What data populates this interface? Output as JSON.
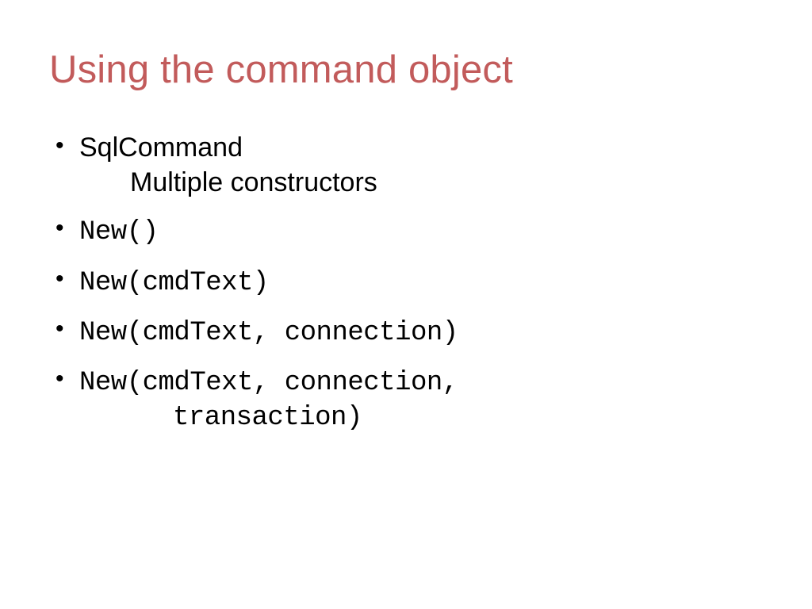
{
  "title": "Using the command object",
  "bullets": {
    "b1_line1": "SqlCommand",
    "b1_line2": "Multiple constructors",
    "b2": "New()",
    "b3": "New(cmdText)",
    "b4": "New(cmdText, connection)",
    "b5_line1": "New(cmdText, connection,",
    "b5_line2": "transaction)"
  }
}
